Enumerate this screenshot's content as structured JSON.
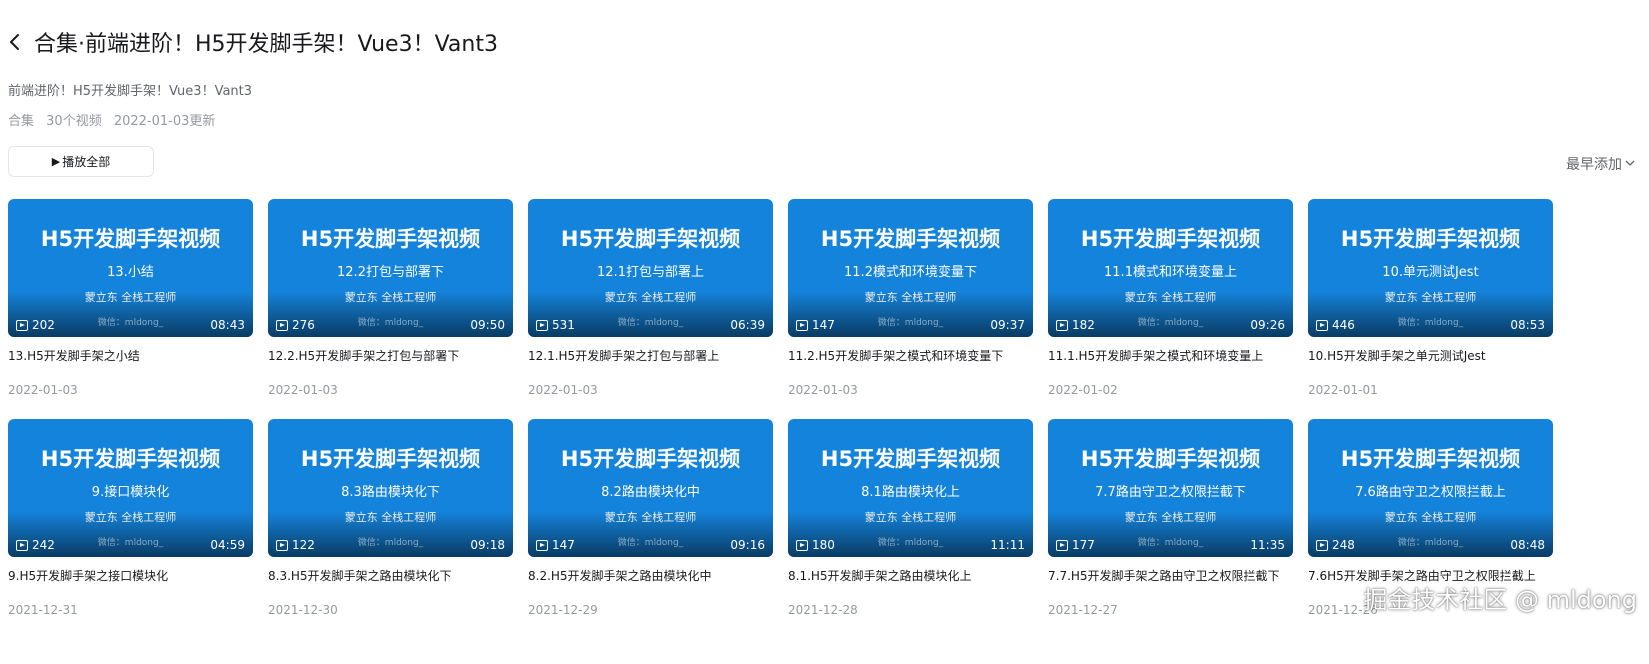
{
  "header": {
    "title": "合集·前端进阶！H5开发脚手架！Vue3！Vant3",
    "back_icon": "chevron-left-icon"
  },
  "description": "前端进阶！H5开发脚手架！Vue3！Vant3",
  "meta": {
    "type": "合集",
    "count": "30个视频",
    "updated": "2022-01-03更新"
  },
  "play_all_label": "播放全部",
  "sort_label": "最早添加",
  "thumb_common": {
    "heading": "H5开发脚手架视频",
    "author": "蒙立东 全栈工程师",
    "watermark": "微信：mldong_",
    "bg_color": "#1483db"
  },
  "videos": [
    {
      "thumb_subtitle": "13.小结",
      "views": "202",
      "duration": "08:43",
      "title": "13.H5开发脚手架之小结",
      "date": "2022-01-03"
    },
    {
      "thumb_subtitle": "12.2打包与部署下",
      "views": "276",
      "duration": "09:50",
      "title": "12.2.H5开发脚手架之打包与部署下",
      "date": "2022-01-03"
    },
    {
      "thumb_subtitle": "12.1打包与部署上",
      "views": "531",
      "duration": "06:39",
      "title": "12.1.H5开发脚手架之打包与部署上",
      "date": "2022-01-03"
    },
    {
      "thumb_subtitle": "11.2模式和环境变量下",
      "views": "147",
      "duration": "09:37",
      "title": "11.2.H5开发脚手架之模式和环境变量下",
      "date": "2022-01-03"
    },
    {
      "thumb_subtitle": "11.1模式和环境变量上",
      "views": "182",
      "duration": "09:26",
      "title": "11.1.H5开发脚手架之模式和环境变量上",
      "date": "2022-01-02"
    },
    {
      "thumb_subtitle": "10.单元测试Jest",
      "views": "446",
      "duration": "08:53",
      "title": "10.H5开发脚手架之单元测试Jest",
      "date": "2022-01-01"
    },
    {
      "thumb_subtitle": "9.接口模块化",
      "views": "242",
      "duration": "04:59",
      "title": "9.H5开发脚手架之接口模块化",
      "date": "2021-12-31"
    },
    {
      "thumb_subtitle": "8.3路由模块化下",
      "views": "122",
      "duration": "09:18",
      "title": "8.3.H5开发脚手架之路由模块化下",
      "date": "2021-12-30"
    },
    {
      "thumb_subtitle": "8.2路由模块化中",
      "views": "147",
      "duration": "09:16",
      "title": "8.2.H5开发脚手架之路由模块化中",
      "date": "2021-12-29"
    },
    {
      "thumb_subtitle": "8.1路由模块化上",
      "views": "180",
      "duration": "11:11",
      "title": "8.1.H5开发脚手架之路由模块化上",
      "date": "2021-12-28"
    },
    {
      "thumb_subtitle": "7.7路由守卫之权限拦截下",
      "views": "177",
      "duration": "11:35",
      "title": "7.7.H5开发脚手架之路由守卫之权限拦截下",
      "date": "2021-12-27"
    },
    {
      "thumb_subtitle": "7.6路由守卫之权限拦截上",
      "views": "248",
      "duration": "08:48",
      "title": "7.6H5开发脚手架之路由守卫之权限拦截上",
      "date": "2021-12-26"
    }
  ],
  "site_watermark": "掘金技术社区 @ mldong"
}
